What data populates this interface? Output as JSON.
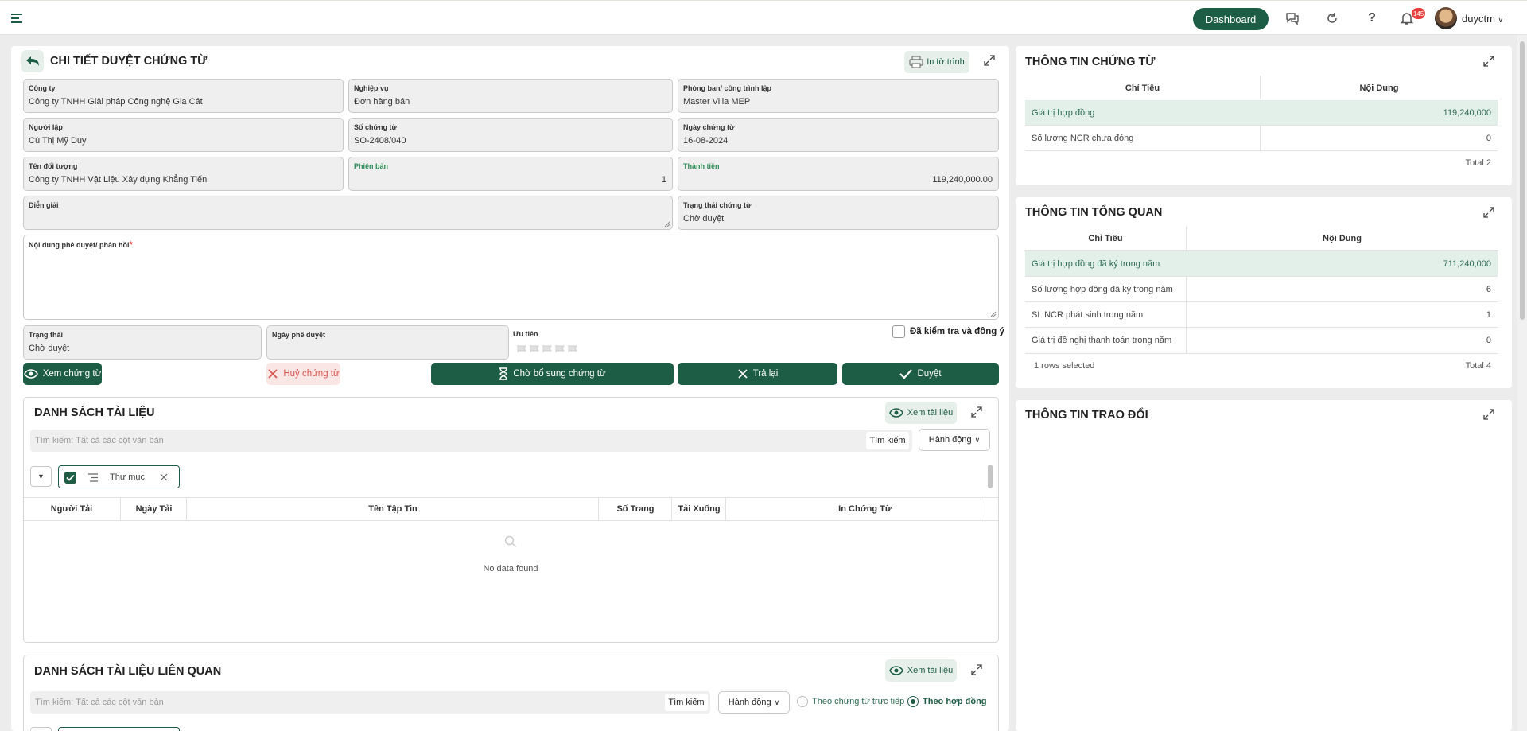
{
  "topbar": {
    "dashboard_label": "Dashboard",
    "notification_count": "145",
    "username": "duyctm",
    "icons": [
      "menu-icon",
      "chat-icon",
      "refresh-icon",
      "help-icon",
      "bell-icon",
      "chevron-down-icon"
    ]
  },
  "detail": {
    "title": "CHI TIẾT DUYỆT CHỨNG TỪ",
    "print_label": "In tờ trình",
    "fields": {
      "company": {
        "label": "Công ty",
        "value": "Công ty TNHH Giải pháp Công nghệ Gia Cát"
      },
      "business": {
        "label": "Nghiệp vụ",
        "value": "Đơn hàng bán"
      },
      "department": {
        "label": "Phòng ban/ công trình lập",
        "value": "Master Villa MEP"
      },
      "creator": {
        "label": "Người lập",
        "value": "Cù Thị Mỹ Duy"
      },
      "doc_number": {
        "label": "Số chứng từ",
        "value": "SO-2408/040"
      },
      "doc_date": {
        "label": "Ngày chứng từ",
        "value": "16-08-2024"
      },
      "partner": {
        "label": "Tên đối tượng",
        "value": "Công ty TNHH Vật Liệu Xây dựng Khẳng Tiến"
      },
      "version": {
        "label": "Phiên bản",
        "value": "1"
      },
      "amount": {
        "label": "Thành tiền",
        "value": "119,240,000.00"
      },
      "description": {
        "label": "Diễn giải",
        "value": ""
      },
      "doc_status": {
        "label": "Trạng thái chứng từ",
        "value": "Chờ duyệt"
      },
      "feedback": {
        "label": "Nội dung phê duyệt/ phản hồi",
        "required_mark": "*",
        "value": ""
      },
      "status": {
        "label": "Trạng thái",
        "value": "Chờ duyệt"
      },
      "approve_date": {
        "label": "Ngày phê duyệt",
        "value": ""
      },
      "priority": {
        "label": "Ưu tiên",
        "value": 0,
        "max": 5
      }
    },
    "checked_agree_label": "Đã kiểm tra và đồng ý",
    "buttons": {
      "view_doc": "Xem chứng từ",
      "cancel_doc": "Huỷ chứng từ",
      "wait_more": "Chờ bổ sung chứng từ",
      "return": "Trả lại",
      "approve": "Duyệt"
    }
  },
  "doc_list": {
    "title": "DANH SÁCH TÀI LIỆU",
    "view_label": "Xem tài liệu",
    "search_placeholder": "Tìm kiếm: Tất cả các cột văn bản",
    "search_button": "Tìm kiếm",
    "action_label": "Hành động",
    "group_chip": "Thư mục",
    "columns": [
      "Người Tải",
      "Ngày Tải",
      "Tên Tập Tin",
      "Số Trang",
      "Tải Xuống",
      "In Chứng Từ"
    ],
    "empty_text": "No data found"
  },
  "related_list": {
    "title": "DANH SÁCH TÀI LIỆU LIÊN QUAN",
    "view_label": "Xem tài liệu",
    "search_placeholder": "Tìm kiếm: Tất cả các cột văn bản",
    "search_button": "Tìm kiếm",
    "action_label": "Hành động",
    "radio_direct": "Theo chứng từ trực tiếp",
    "radio_contract": "Theo hợp đồng",
    "selected_radio": "Theo hợp đồng"
  },
  "doc_info": {
    "title": "THÔNG TIN CHỨNG TỪ",
    "columns": [
      "Chỉ Tiêu",
      "Nội Dung"
    ],
    "rows": [
      {
        "label": "Giá trị hợp đồng",
        "value": "119,240,000"
      },
      {
        "label": "Số lượng NCR chưa đóng",
        "value": "0"
      }
    ],
    "footer_total": "Total 2"
  },
  "overview": {
    "title": "THÔNG TIN TỔNG QUAN",
    "columns": [
      "Chỉ Tiêu",
      "Nội Dung"
    ],
    "rows": [
      {
        "label": "Giá trị hợp đồng đã ký trong năm",
        "value": "711,240,000"
      },
      {
        "label": "Số lượng hợp đồng đã ký trong năm",
        "value": "6"
      },
      {
        "label": "SL NCR phát sinh trong năm",
        "value": "1"
      },
      {
        "label": "Giá trị đề nghị thanh toán trong năm",
        "value": "0"
      }
    ],
    "footer_selected": "1 rows selected",
    "footer_total": "Total 4"
  },
  "exchange": {
    "title": "THÔNG TIN TRAO ĐỔI"
  },
  "colors": {
    "primary": "#1e5d45",
    "highlight_row": "#e3f0ea",
    "danger": "#d9534f"
  }
}
